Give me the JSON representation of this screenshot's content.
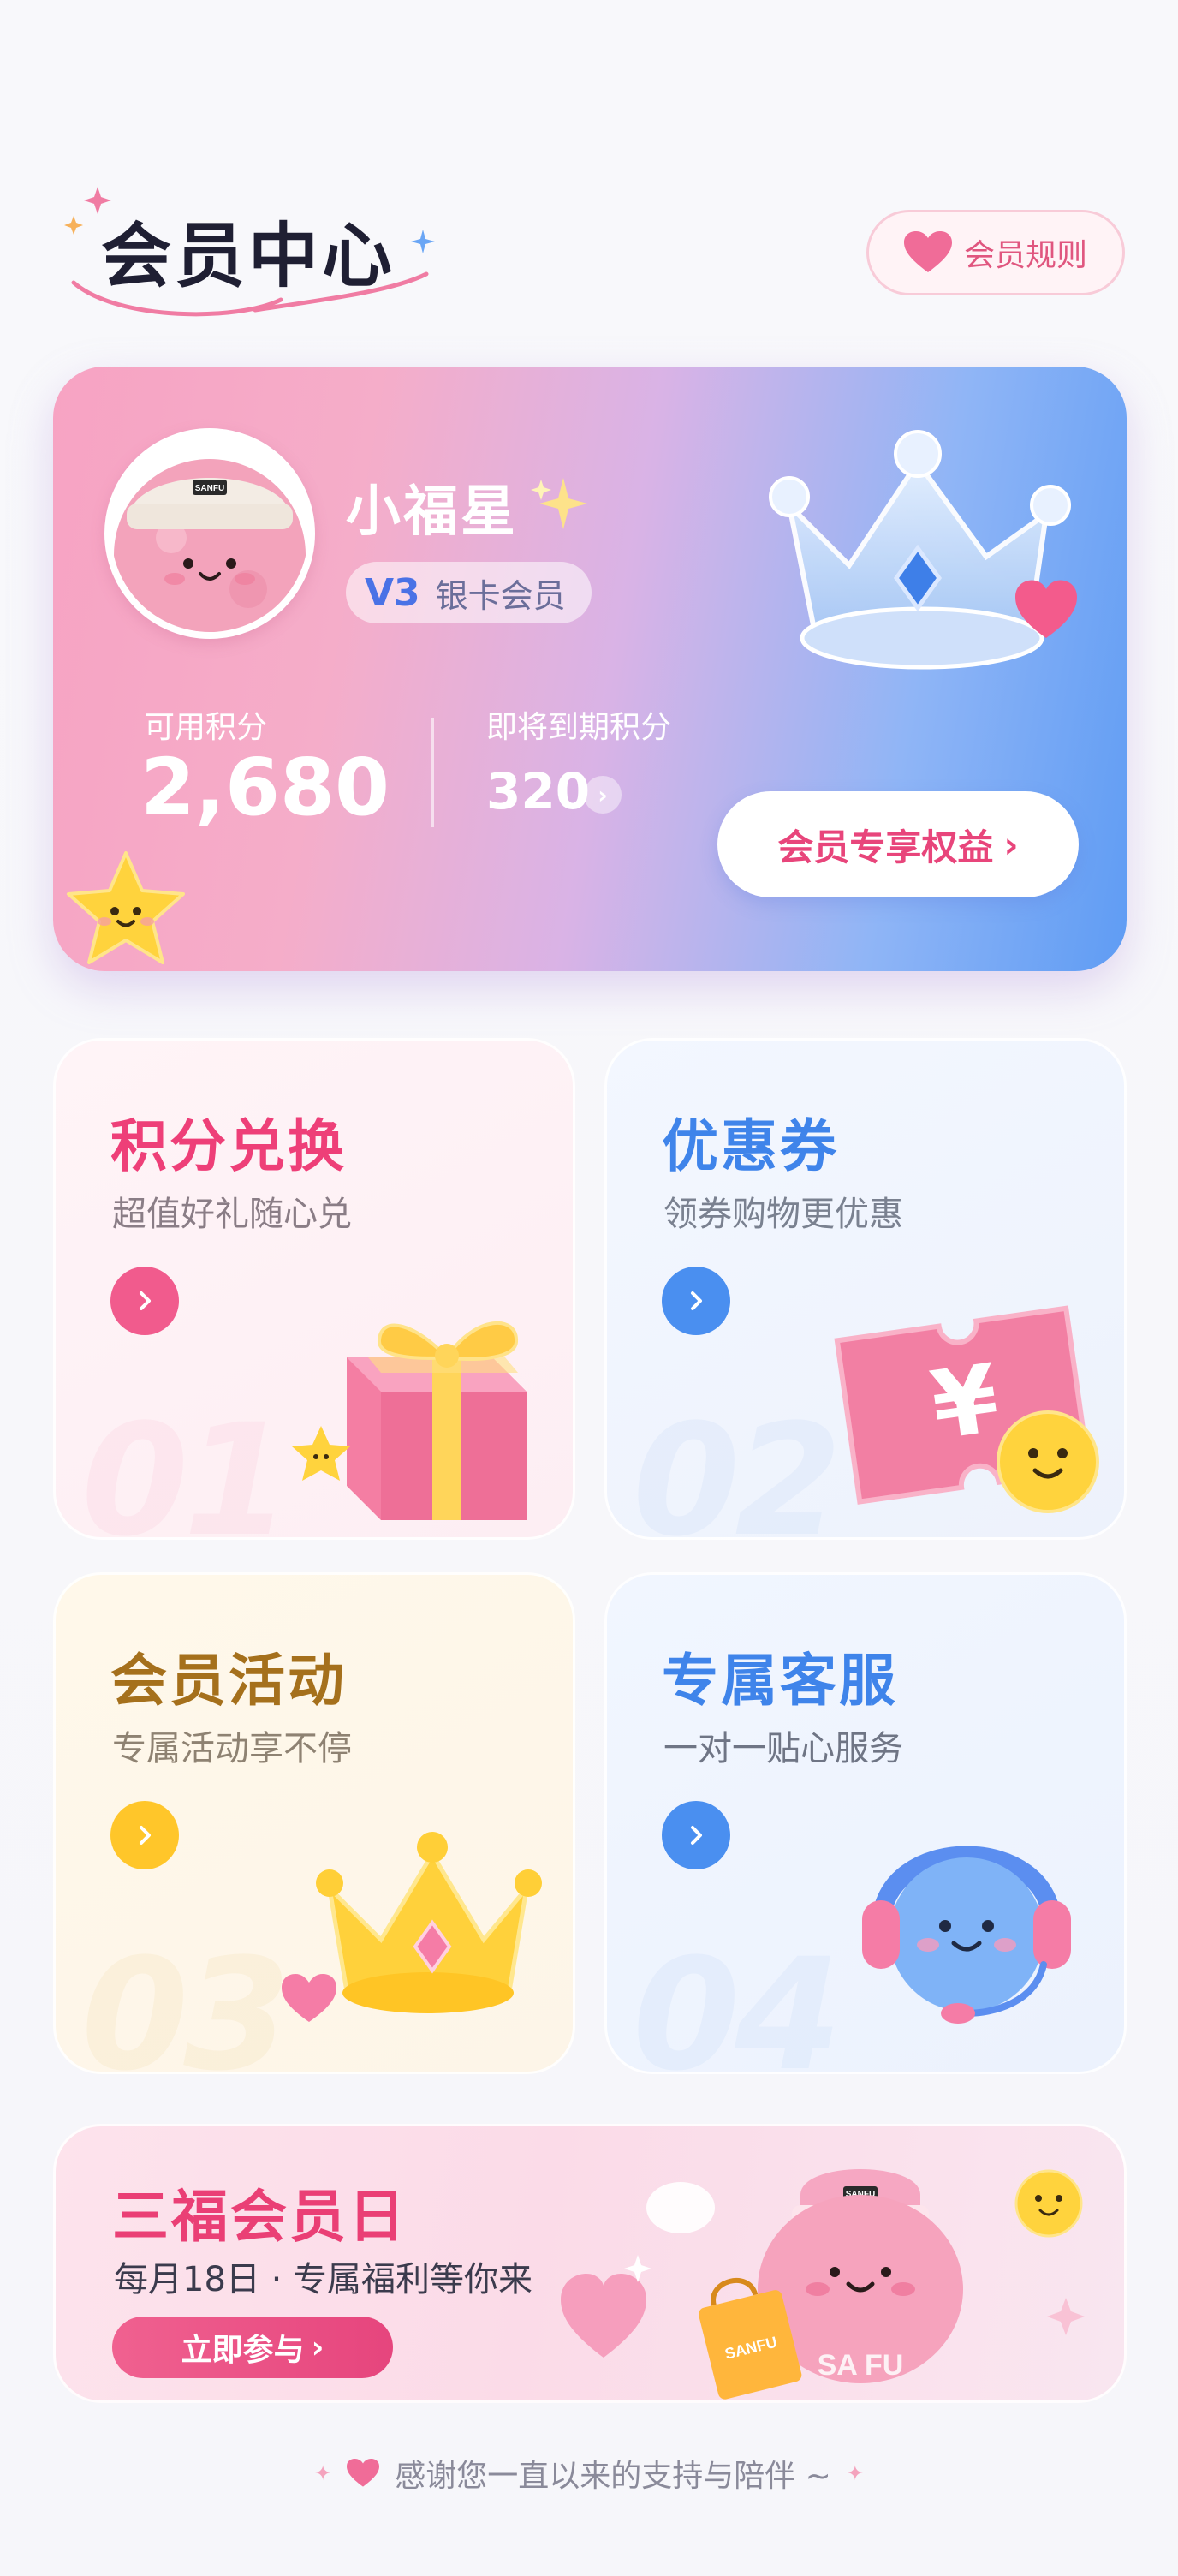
{
  "header": {
    "title": "会员中心",
    "rules_label": "会员规则"
  },
  "member": {
    "name": "小福星",
    "level_code": "V3",
    "level_name": "银卡会员",
    "avatar_text": "SANFU",
    "available_points_label": "可用积分",
    "available_points": "2,680",
    "expiring_points_label": "即将到期积分",
    "expiring_points": "320",
    "benefits_button": "会员专享权益"
  },
  "tiles": [
    {
      "title": "积分兑换",
      "subtitle": "超值好礼随心兑",
      "number": "01",
      "accent": "#ee3f78"
    },
    {
      "title": "优惠券",
      "subtitle": "领券购物更优惠",
      "number": "02",
      "accent": "#3f84ea"
    },
    {
      "title": "会员活动",
      "subtitle": "专属活动享不停",
      "number": "03",
      "accent": "#a5701c"
    },
    {
      "title": "专属客服",
      "subtitle": "一对一贴心服务",
      "number": "04",
      "accent": "#3f84ea"
    }
  ],
  "banner": {
    "title": "三福会员日",
    "subtitle": "每月18日 · 专属福利等你来",
    "button": "立即参与",
    "mascot_text": "SANFU",
    "bag_text": "SANFU",
    "hoodie_text": "SA  FU"
  },
  "footer": {
    "note": "感谢您一直以来的支持与陪伴 ~"
  },
  "colors": {
    "pink": "#ea3f75",
    "blue": "#3f84ea",
    "gold": "#a5701c",
    "coupon_pink": "#f27fa3"
  }
}
